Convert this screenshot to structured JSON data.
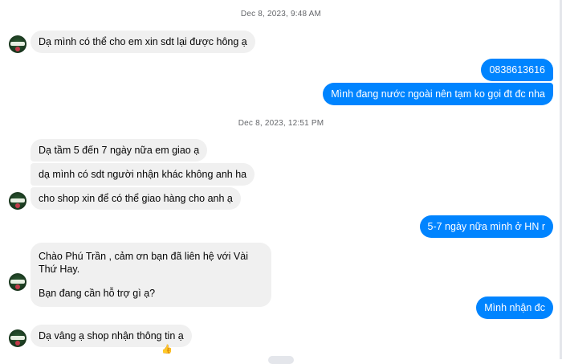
{
  "timestamps": [
    "Dec 8, 2023, 9:48 AM",
    "Dec 8, 2023, 12:51 PM"
  ],
  "messages": {
    "m1": "Dạ mình có thể cho em xin sdt lại được hông ạ",
    "m2": "0838613616",
    "m3": "Mình đang nước ngoài nên tạm ko gọi đt đc nha",
    "m4": "Dạ tầm 5 đến 7 ngày nữa em giao ạ",
    "m5": "dạ mình có sdt người nhận khác không anh ha",
    "m6": "cho shop xin để có thể giao hàng cho anh ạ",
    "m7": "5-7 ngày nữa mình ở HN r",
    "m8a": "Chào Phú Trần , cảm ơn bạn đã liên hệ với Vài Thứ Hay.",
    "m8b": "Bạn đang cần hỗ trợ gì ạ?",
    "m9": "Mình nhận đc",
    "m10": "Dạ vâng ạ shop nhận thông tin ạ",
    "reaction": "👍"
  },
  "colors": {
    "incoming_bubble": "#f0f0f0",
    "outgoing_bubble": "#0084ff",
    "timestamp_text": "#65676b"
  },
  "icons": {
    "avatar": "shop-avatar-icon",
    "reaction": "thumbs-up-icon"
  }
}
